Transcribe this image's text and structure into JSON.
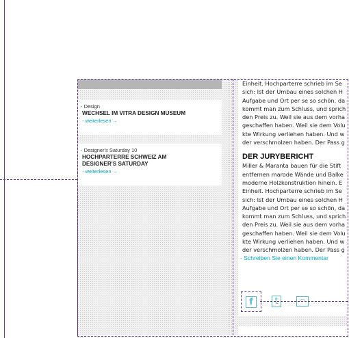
{
  "sidebar": {
    "items": [
      {
        "category": "- Design",
        "title": "WECHSEL IM VITRA DESIGN MUSEUM",
        "more": "- weiterlesen"
      },
      {
        "category": "- Designer's Saturday 10",
        "title_lines": [
          "HOCHPARTERRE SCHWEIZ AM",
          "DESIGNER'S SATURDAY"
        ],
        "more": "- weiterlesen"
      }
    ]
  },
  "article": {
    "lines_top": [
      "Einheit. Hochparterre schrieb im Se",
      "sich: Ist der Umbau eines solchen H",
      "Aufgabe und Ort per se so schön, da",
      "kommt man zum Schluss, und sprich",
      "den Preis zu. Weil sie aus dem vorha",
      "geschaffen haben. Weil sie dem Volu",
      "kte Wirkung verliehen haben. Und w",
      "der verschmolzen haben. Der Pass g"
    ],
    "heading": "DER JURYBERICHT",
    "lines_bottom": [
      "Miller & Maranta bauen für die Stift",
      "entfernen marode Wände und Balke",
      "moderne Holzkonstruktion hinein. E",
      "Einheit. Hochparterre schrieb im Se",
      "sich: Ist der Umbau eines solchen H",
      "Aufgabe und Ort per se so schön, da",
      "kommt man zum Schluss, und sprich",
      "den Preis zu. Weil sie aus dem vorha",
      "geschaffen haben. Weil sie dem Volu",
      "kte Wirkung verliehen haben. Und w",
      "der verschmolzen haben. Der Pass g"
    ],
    "comment_link": "- Schreiben Sie einen Kommentar"
  },
  "share": {
    "facebook_glyph": "f",
    "twitter_glyph": "t",
    "rss_glyph": "◠"
  },
  "colors": {
    "accent": "#00a8c6",
    "guide": "#5b2a86"
  }
}
